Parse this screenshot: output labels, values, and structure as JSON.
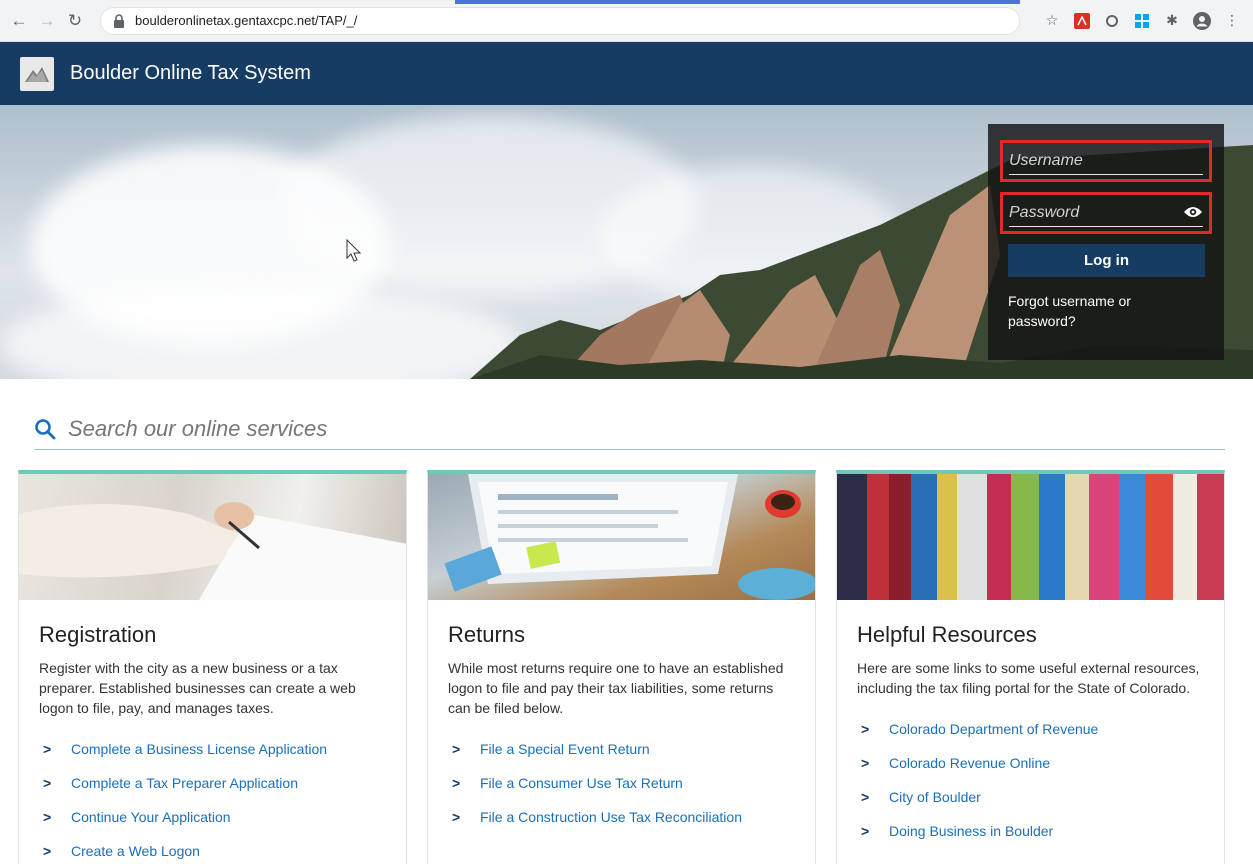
{
  "browser": {
    "url": "boulderonlinetax.gentaxcpc.net/TAP/_/"
  },
  "app": {
    "title": "Boulder Online Tax System"
  },
  "login": {
    "username_placeholder": "Username",
    "password_placeholder": "Password",
    "login_label": "Log in",
    "forgot_label": "Forgot username or password?"
  },
  "search": {
    "placeholder": "Search our online services"
  },
  "cards": [
    {
      "title": "Registration",
      "description": "Register with the city as a new business or a tax preparer. Established businesses can create a web logon to file, pay, and manages taxes.",
      "links": [
        "Complete a Business License Application",
        "Complete a Tax Preparer Application",
        "Continue Your Application",
        "Create a Web Logon"
      ]
    },
    {
      "title": "Returns",
      "description": "While most returns require one to have an established logon to file and pay their tax liabilities, some returns can be filed below.",
      "links": [
        "File a Special Event Return",
        "File a Consumer Use Tax Return",
        "File a Construction Use Tax Reconciliation"
      ]
    },
    {
      "title": "Helpful Resources",
      "description": "Here are some links to some useful external resources, including the tax filing portal for the State of Colorado.",
      "links": [
        "Colorado Department of Revenue",
        "Colorado Revenue Online",
        "City of Boulder",
        "Doing Business in Boulder"
      ]
    }
  ],
  "colors": {
    "header_bg": "#163c63",
    "accent_teal": "#6fc9b8",
    "link": "#1c6fb8",
    "highlight": "#e0292b"
  }
}
